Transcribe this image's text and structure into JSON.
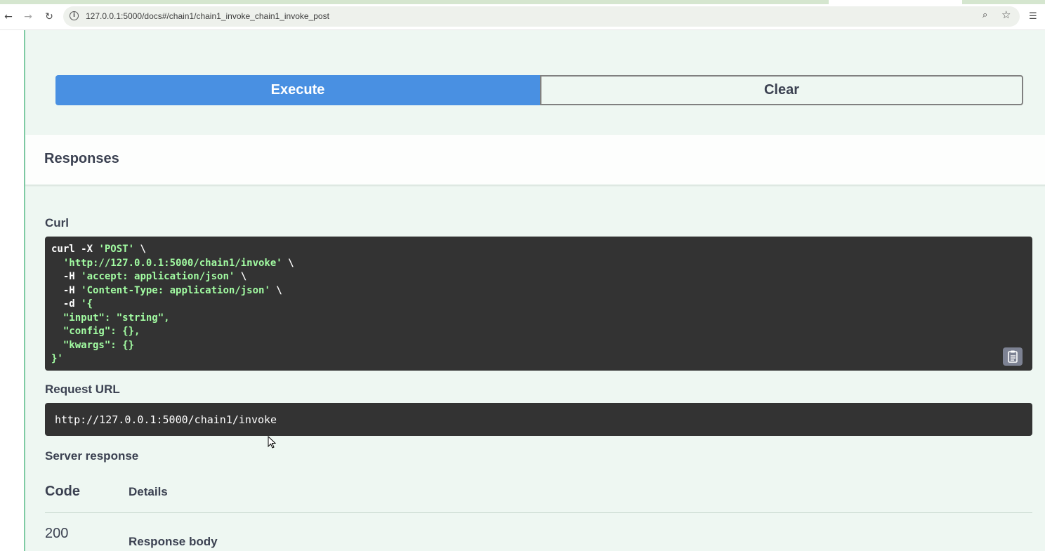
{
  "browser": {
    "url": "127.0.0.1:5000/docs#/chain1/chain1_invoke_chain1_invoke_post",
    "back_icon": "←",
    "forward_icon": "→",
    "reload_icon": "↻",
    "info_icon": "i",
    "zoom_icon": "⌕",
    "bookmark_icon": "☆",
    "reading_list_icon": "☰"
  },
  "actions": {
    "execute_label": "Execute",
    "clear_label": "Clear"
  },
  "responses": {
    "title": "Responses",
    "curl_label": "Curl",
    "curl_lines": [
      {
        "plain": "curl -X ",
        "str": "'POST'",
        "tail": " \\"
      },
      {
        "plain": "  ",
        "str": "'http://127.0.0.1:5000/chain1/invoke'",
        "tail": " \\"
      },
      {
        "plain": "  -H ",
        "str": "'accept: application/json'",
        "tail": " \\"
      },
      {
        "plain": "  -H ",
        "str": "'Content-Type: application/json'",
        "tail": " \\"
      },
      {
        "plain": "  -d ",
        "str": "'{",
        "tail": ""
      },
      {
        "plain": "",
        "str": "  \"input\": \"string\",",
        "tail": ""
      },
      {
        "plain": "",
        "str": "  \"config\": {},",
        "tail": ""
      },
      {
        "plain": "",
        "str": "  \"kwargs\": {}",
        "tail": ""
      },
      {
        "plain": "",
        "str": "}'",
        "tail": ""
      }
    ],
    "request_url_label": "Request URL",
    "request_url": "http://127.0.0.1:5000/chain1/invoke",
    "server_response_label": "Server response",
    "table": {
      "col_code": "Code",
      "col_details": "Details",
      "status_code": "200",
      "response_body_label": "Response body"
    }
  },
  "colors": {
    "execute_bg": "#4990e2",
    "opblock_bg": "#eef7f2",
    "code_bg": "#333333",
    "code_string": "#a2fca2"
  }
}
